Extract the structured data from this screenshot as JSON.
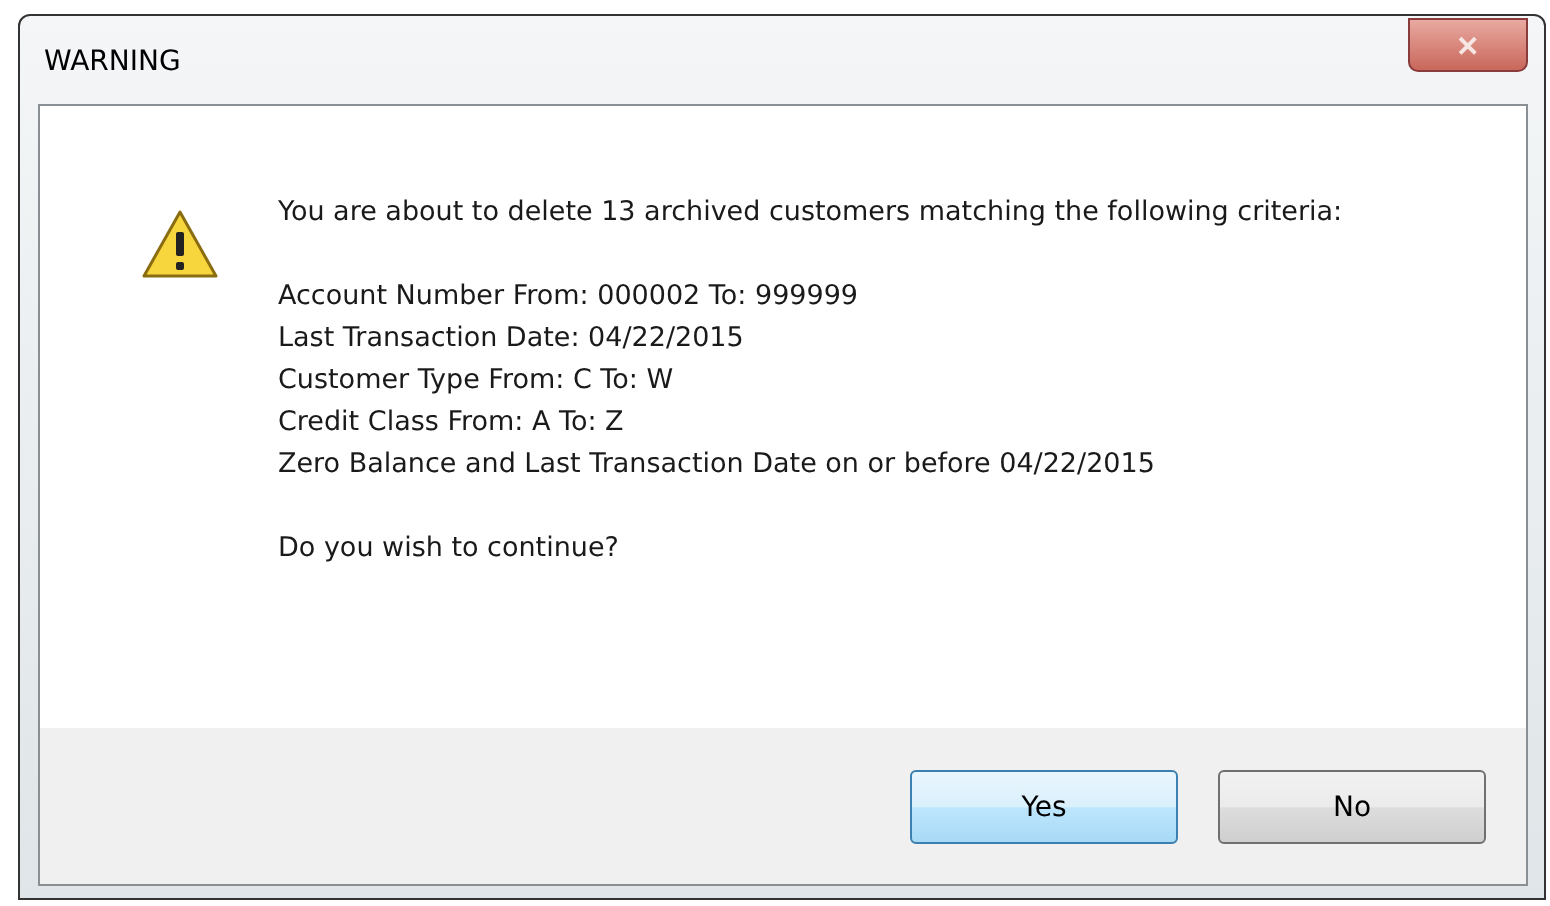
{
  "window": {
    "title": "WARNING",
    "close": "✕"
  },
  "message": "You are about to delete 13 archived customers matching the following criteria:",
  "criteria": [
    "Account Number From: 000002 To: 999999",
    "Last Transaction Date: 04/22/2015",
    "Customer Type From: C To: W",
    "Credit Class From: A To: Z",
    "Zero Balance and Last Transaction Date on or before 04/22/2015"
  ],
  "question": "Do you wish to continue?",
  "buttons": [
    {
      "label": "Yes",
      "default": true
    },
    {
      "label": "No",
      "default": false
    }
  ]
}
